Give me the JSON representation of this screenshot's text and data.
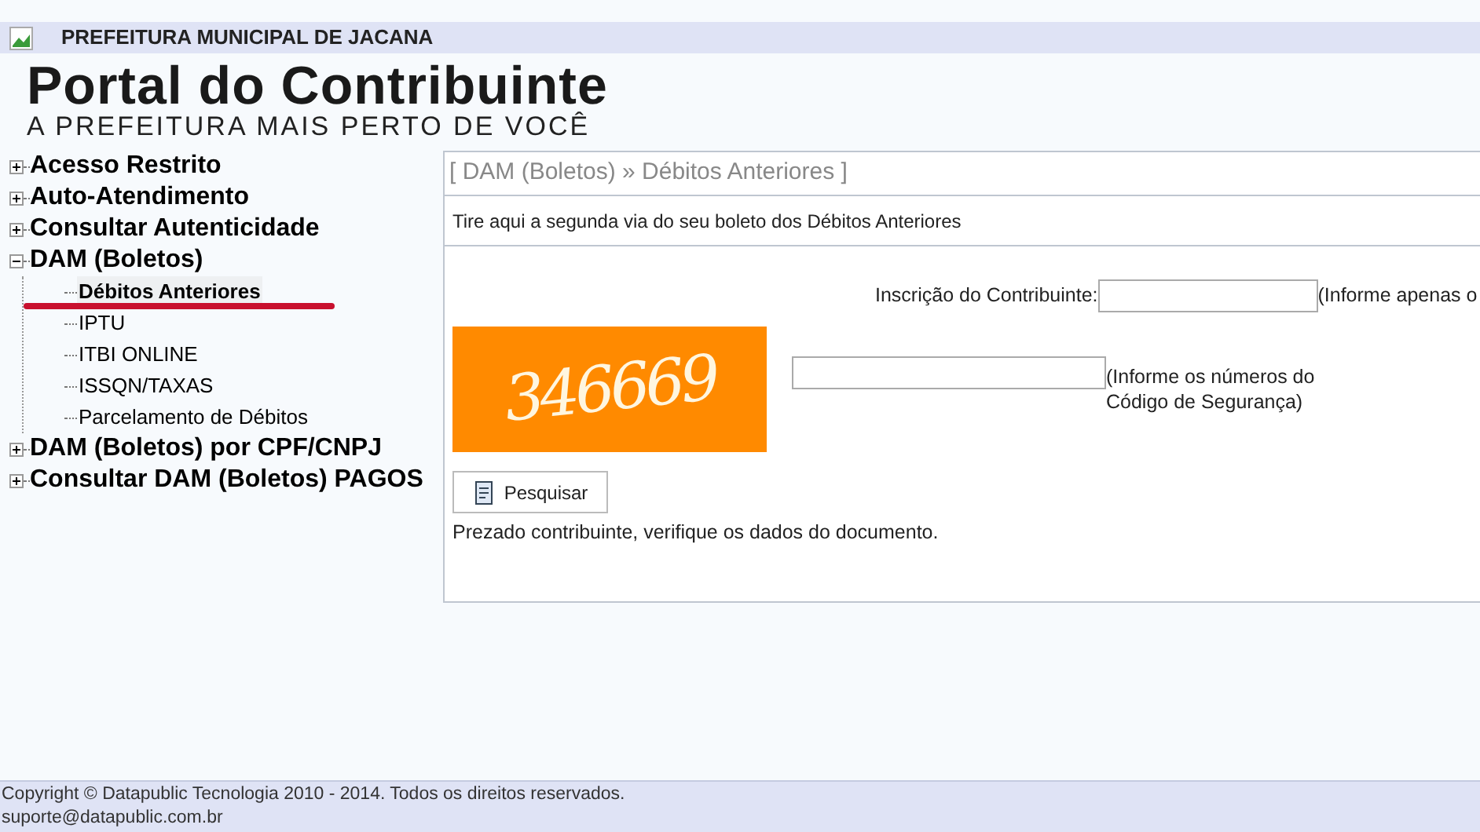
{
  "header": {
    "title": "PREFEITURA MUNICIPAL DE JACANA"
  },
  "logo": {
    "title": "Portal do Contribuinte",
    "tagline": "A PREFEITURA MAIS PERTO DE VOCÊ"
  },
  "menu": [
    {
      "label": "Acesso Restrito",
      "expanded": false
    },
    {
      "label": "Auto-Atendimento",
      "expanded": false
    },
    {
      "label": "Consultar Autenticidade",
      "expanded": false
    },
    {
      "label": "DAM (Boletos)",
      "expanded": true,
      "children": [
        {
          "label": "Débitos Anteriores",
          "selected": true
        },
        {
          "label": "IPTU",
          "selected": false
        },
        {
          "label": "ITBI ONLINE",
          "selected": false
        },
        {
          "label": "ISSQN/TAXAS",
          "selected": false
        },
        {
          "label": "Parcelamento de Débitos",
          "selected": false
        }
      ]
    },
    {
      "label": "DAM (Boletos) por CPF/CNPJ",
      "expanded": false
    },
    {
      "label": "Consultar DAM (Boletos) PAGOS",
      "expanded": false
    }
  ],
  "panel": {
    "breadcrumb": "[ DAM (Boletos) » Débitos Anteriores ]",
    "description": "Tire aqui a segunda via do seu boleto dos Débitos Anteriores",
    "registration_label": "Inscrição do Contribuinte:",
    "registration_hint": "(Informe apenas o",
    "captcha": "346669",
    "captcha_hint": "(Informe os números do Código de Segurança)",
    "search_button": "Pesquisar",
    "message": "Prezado contribuinte, verifique os dados do documento."
  },
  "footer": {
    "copyright": "Copyright © Datapublic Tecnologia 2010 - 2014. Todos os direitos reservados.",
    "email": "suporte@datapublic.com.br"
  }
}
